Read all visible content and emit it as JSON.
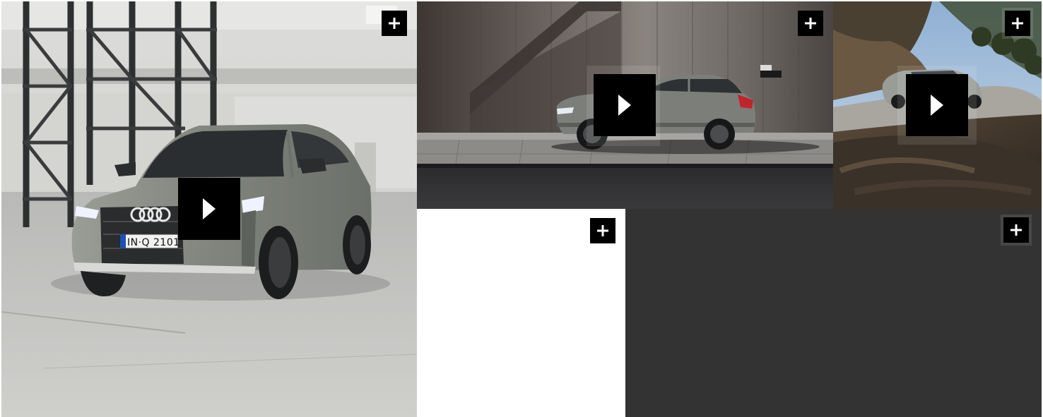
{
  "gallery": {
    "tiles": [
      {
        "id": "tile-1",
        "kind": "video",
        "plate": "IN·Q 2101",
        "expand_icon": "plus-icon",
        "play_icon": "play-icon"
      },
      {
        "id": "tile-2",
        "kind": "video",
        "expand_icon": "plus-icon",
        "play_icon": "play-icon"
      },
      {
        "id": "tile-3",
        "kind": "video",
        "expand_icon": "plus-icon",
        "play_icon": "play-icon"
      },
      {
        "id": "tile-4",
        "kind": "image",
        "expand_icon": "plus-icon"
      },
      {
        "id": "tile-5",
        "kind": "image",
        "expand_icon": "plus-icon"
      }
    ]
  },
  "colors": {
    "button_bg": "#000000",
    "button_fg": "#ffffff",
    "dark_tile": "#333333",
    "light_tile": "#ffffff",
    "car_body": "#8a8f88"
  }
}
